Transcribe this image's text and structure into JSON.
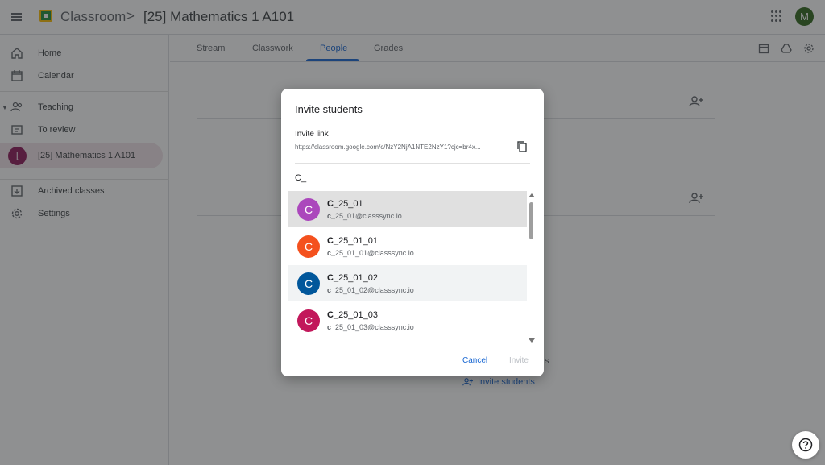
{
  "header": {
    "app_name": "Classroom",
    "breadcrumb_sep": ">",
    "class_title": "[25] Mathematics 1 A101",
    "avatar_letter": "M"
  },
  "sidebar": {
    "items": [
      {
        "label": "Home",
        "icon": "home-icon"
      },
      {
        "label": "Calendar",
        "icon": "calendar-icon"
      },
      {
        "label": "Teaching",
        "icon": "people-icon"
      },
      {
        "label": "To review",
        "icon": "review-icon"
      },
      {
        "label": "[25] Mathematics 1 A101",
        "icon": "class-chip",
        "chip_letter": "[",
        "active": true
      },
      {
        "label": "Archived classes",
        "icon": "archive-icon"
      },
      {
        "label": "Settings",
        "icon": "gear-icon"
      }
    ]
  },
  "tabs": [
    {
      "label": "Stream"
    },
    {
      "label": "Classwork"
    },
    {
      "label": "People",
      "active": true
    },
    {
      "label": "Grades"
    }
  ],
  "background": {
    "partial_text": "s",
    "invite_students": "Invite students"
  },
  "dialog": {
    "title": "Invite students",
    "invite_link_label": "Invite link",
    "invite_link_url": "https://classroom.google.com/c/NzY2NjA1NTE2NzY1?cjc=br4x...",
    "search_value": "C_",
    "results": [
      {
        "name_bold": "C_",
        "name_rest": "25_01",
        "email_bold": "c_",
        "email_rest": "25_01@classsync.io",
        "color": "#ab47bc",
        "letter": "C"
      },
      {
        "name_bold": "C_",
        "name_rest": "25_01_01",
        "email_bold": "c_",
        "email_rest": "25_01_01@classsync.io",
        "color": "#f4511e",
        "letter": "C"
      },
      {
        "name_bold": "C_",
        "name_rest": "25_01_02",
        "email_bold": "c_",
        "email_rest": "25_01_02@classsync.io",
        "color": "#01579b",
        "letter": "C"
      },
      {
        "name_bold": "C_",
        "name_rest": "25_01_03",
        "email_bold": "c_",
        "email_rest": "25_01_03@classsync.io",
        "color": "#c2185b",
        "letter": "C"
      }
    ],
    "cancel_label": "Cancel",
    "invite_label": "Invite"
  },
  "colors": {
    "accent": "#1967d2",
    "active_item_bg": "#f1e3e8",
    "class_chip": "#8e1b5a",
    "avatar": "#33691e"
  }
}
